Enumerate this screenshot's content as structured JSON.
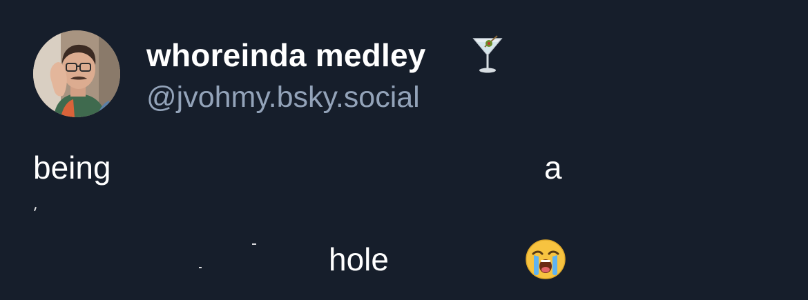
{
  "post": {
    "author": {
      "display_name": "whoreinda medley",
      "name_emoji_icon": "martini-glass-icon",
      "handle": "@jvohmy.bsky.social",
      "avatar_icon": "user-avatar-photo"
    },
    "body": {
      "word_1": "being",
      "word_2": "a",
      "word_3": "hole",
      "emoji_icon": "loudly-crying-face-icon"
    }
  },
  "colors": {
    "background": "#161e2b",
    "text": "#ffffff",
    "handle": "#93a3b9"
  }
}
